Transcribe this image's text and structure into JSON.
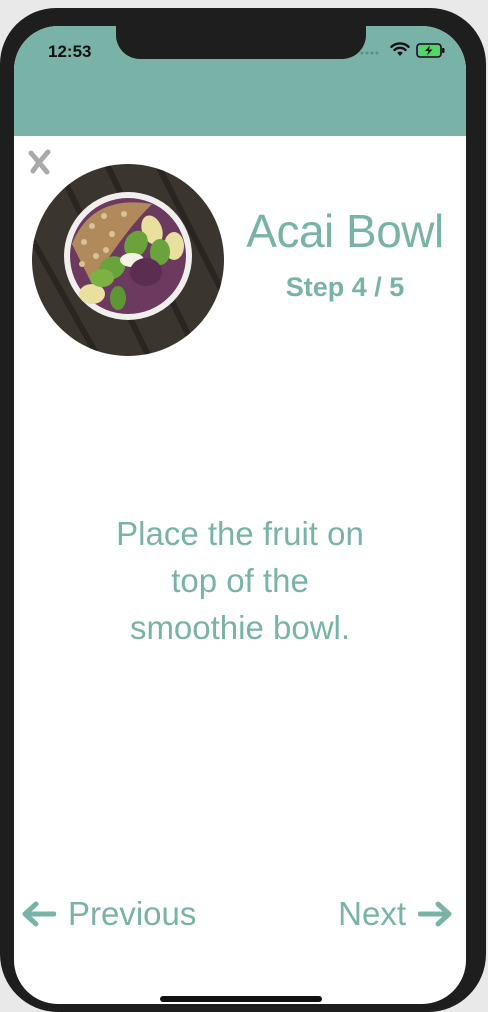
{
  "status_bar": {
    "time": "12:53",
    "icons": [
      "signal-icon",
      "wifi-icon",
      "battery-charging-icon"
    ]
  },
  "recipe": {
    "title": "Acai Bowl",
    "step_label": "Step 4 / 5",
    "instruction": "Place the fruit on top of the smoothie bowl.",
    "instruction_lines": [
      "Place the fruit on",
      "top of the",
      "smoothie bowl."
    ]
  },
  "nav": {
    "previous_label": "Previous",
    "next_label": "Next"
  },
  "colors": {
    "accent": "#79b3a8",
    "close_icon": "#a9a9a9"
  }
}
